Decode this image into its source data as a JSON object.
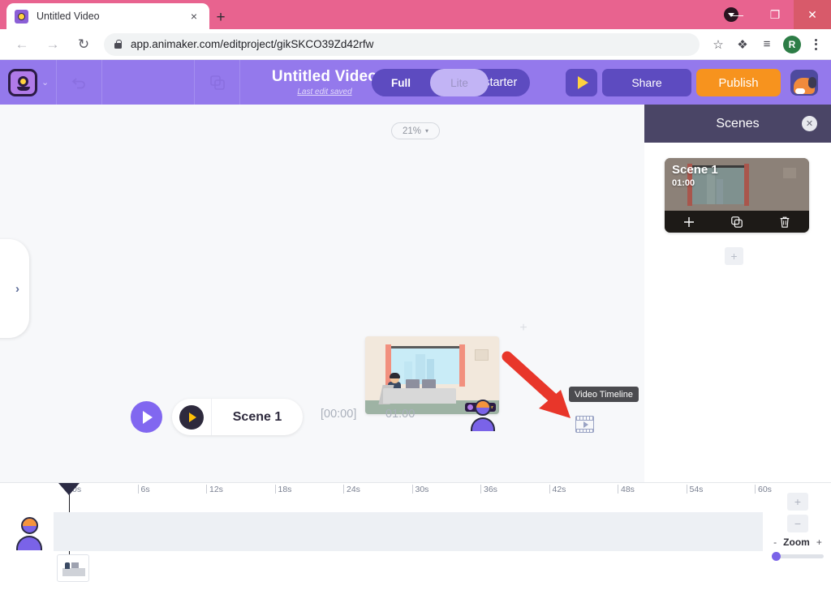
{
  "browser": {
    "tab": {
      "title": "Untitled Video",
      "favicon": "animaker-favicon",
      "close": "×"
    },
    "new_tab": "+",
    "window_controls": {
      "minimize": "—",
      "maximize": "❐",
      "close": "✕"
    },
    "nav": {
      "back": "←",
      "forward": "→",
      "reload": "↻"
    },
    "url": "app.animaker.com/editproject/gikSKCO39Zd42rfw",
    "toolbar_icons": {
      "bookmark": "☆",
      "extensions": "❖",
      "media": "≡",
      "profile_initial": "R"
    }
  },
  "app_header": {
    "logo": "animaker-logo",
    "logo_caret": "⌄",
    "undo_icon": "undo-arrow",
    "duplicate_icon": "duplicate-squares",
    "project_title": "Untitled Video",
    "save_status": "Last edit saved",
    "mode_toggle": {
      "full": "Full",
      "lite": "Lite",
      "active": "Lite"
    },
    "upgrade_label": "e to starter",
    "preview_icon": "play-triangle",
    "share_label": "Share",
    "publish_label": "Publish",
    "account_avatar": "dog-avatar"
  },
  "canvas": {
    "expand_handle": "›",
    "zoom_value": "21%",
    "zoom_caret": "▾",
    "add_marker": "+",
    "stage_alt": "office-desk-scene",
    "watermark": "Animaker"
  },
  "scene_bar": {
    "play_label": "play-scene",
    "chip_play": "play-chip",
    "scene_name": "Scene 1",
    "current_time": "[00:00]",
    "duration": "01:00",
    "character_icon": "character-avatar",
    "video_timeline_icon": "video-timeline-icon",
    "tooltip": "Video Timeline"
  },
  "scenes_panel": {
    "title": "Scenes",
    "close": "✕",
    "scene": {
      "name": "Scene 1",
      "duration": "01:00",
      "actions": {
        "add": "+",
        "duplicate": "⧉",
        "delete": "Ὕ1"
      }
    },
    "add_scene": "+"
  },
  "timeline": {
    "ticks": [
      "0s",
      "6s",
      "12s",
      "18s",
      "24s",
      "30s",
      "36s",
      "42s",
      "48s",
      "54s",
      "60s"
    ],
    "playhead_position_s": 0,
    "track_avatar": "character-avatar",
    "track_clip": "scene-1-thumbnail",
    "zoom": {
      "plus": "+",
      "minus": "−",
      "minus_label": "-",
      "label": "Zoom",
      "plus_label": "+",
      "slider_value": 5
    }
  },
  "annotation": {
    "arrow": "red-arrow-pointer",
    "color": "#e8362a"
  },
  "colors": {
    "title_bar": "#e8638f",
    "app_header": "#9479ec",
    "publish": "#f7931e",
    "scenes_header": "#4a4566",
    "accent_purple": "#7a63e8"
  }
}
